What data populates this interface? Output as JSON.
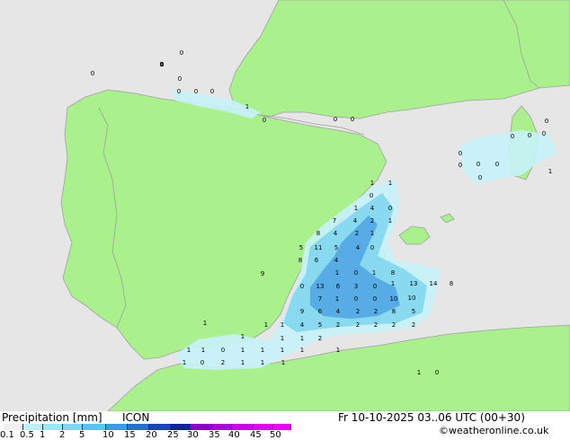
{
  "title": "Precipitation [mm]",
  "model": "ICON",
  "datetime": "Fr 10-10-2025 03..06 UTC (00+30)",
  "credit": "©weatheronline.co.uk",
  "legend": {
    "ticks": [
      "0.1",
      "0.5",
      "1",
      "2",
      "5",
      "10",
      "15",
      "20",
      "25",
      "30",
      "35",
      "40",
      "45",
      "50"
    ],
    "colors": [
      "#f0f0f0",
      "#bfeff8",
      "#9fe6f6",
      "#7ad8f0",
      "#55c6ec",
      "#3a9be0",
      "#2a6ed0",
      "#1c45bd",
      "#10249f",
      "#8a00c8",
      "#b000d8",
      "#d000e0",
      "#e400e8",
      "#f000f0"
    ]
  },
  "colors": {
    "sea": "#e6e6e6",
    "land": "#aaf08c",
    "border": "#a0a0a0",
    "precip_light": "#c8f2fa",
    "precip_med": "#7fd8f2",
    "precip_heavy": "#48a6e6"
  },
  "map_values": [
    {
      "v": "0"
    },
    {
      "v": "0"
    },
    {
      "v": "0"
    },
    {
      "v": "0"
    },
    {
      "v": "0"
    },
    {
      "v": "0"
    },
    {
      "v": "0"
    },
    {
      "v": "0"
    },
    {
      "v": "1"
    },
    {
      "v": "0"
    },
    {
      "v": "0"
    },
    {
      "v": "0"
    },
    {
      "v": "0"
    },
    {
      "v": "0"
    },
    {
      "v": "0"
    },
    {
      "v": "1"
    },
    {
      "v": "0"
    },
    {
      "v": "0"
    },
    {
      "v": "0"
    },
    {
      "v": "0"
    },
    {
      "v": "0"
    },
    {
      "v": "1"
    },
    {
      "v": "1"
    },
    {
      "v": "0"
    },
    {
      "v": "4"
    },
    {
      "v": "1"
    },
    {
      "v": "0"
    },
    {
      "v": "4"
    },
    {
      "v": "2"
    },
    {
      "v": "1"
    },
    {
      "v": "7"
    },
    {
      "v": "8"
    },
    {
      "v": "4"
    },
    {
      "v": "2"
    },
    {
      "v": "1"
    },
    {
      "v": "5"
    },
    {
      "v": "11"
    },
    {
      "v": "5"
    },
    {
      "v": "4"
    },
    {
      "v": "0"
    },
    {
      "v": "8"
    },
    {
      "v": "6"
    },
    {
      "v": "4"
    },
    {
      "v": "1"
    },
    {
      "v": "0"
    },
    {
      "v": "1"
    },
    {
      "v": "8"
    },
    {
      "v": "0"
    },
    {
      "v": "13"
    },
    {
      "v": "6"
    },
    {
      "v": "3"
    },
    {
      "v": "0"
    },
    {
      "v": "1"
    },
    {
      "v": "13"
    },
    {
      "v": "14"
    },
    {
      "v": "8"
    },
    {
      "v": "9"
    },
    {
      "v": "7"
    },
    {
      "v": "1"
    },
    {
      "v": "0"
    },
    {
      "v": "0"
    },
    {
      "v": "10"
    },
    {
      "v": "10"
    },
    {
      "v": "9"
    },
    {
      "v": "6"
    },
    {
      "v": "4"
    },
    {
      "v": "2"
    },
    {
      "v": "2"
    },
    {
      "v": "8"
    },
    {
      "v": "5"
    },
    {
      "v": "4"
    },
    {
      "v": "5"
    },
    {
      "v": "2"
    },
    {
      "v": "2"
    },
    {
      "v": "2"
    },
    {
      "v": "2"
    },
    {
      "v": "2"
    },
    {
      "v": "1"
    },
    {
      "v": "1"
    },
    {
      "v": "1"
    },
    {
      "v": "1"
    },
    {
      "v": "1"
    },
    {
      "v": "1"
    },
    {
      "v": "2"
    },
    {
      "v": "1"
    },
    {
      "v": "1"
    },
    {
      "v": "0"
    },
    {
      "v": "1"
    },
    {
      "v": "1"
    },
    {
      "v": "1"
    },
    {
      "v": "1"
    },
    {
      "v": "1"
    },
    {
      "v": "1"
    },
    {
      "v": "0"
    },
    {
      "v": "2"
    },
    {
      "v": "1"
    },
    {
      "v": "1"
    },
    {
      "v": "1"
    },
    {
      "v": "1"
    },
    {
      "v": "0"
    },
    {
      "v": "0"
    },
    {
      "v": "0"
    },
    {
      "v": "0"
    },
    {
      "v": "0"
    },
    {
      "v": "1"
    },
    {
      "v": "0"
    },
    {
      "v": "1"
    },
    {
      "v": "0"
    },
    {
      "v": "0"
    },
    {
      "v": "1"
    }
  ]
}
